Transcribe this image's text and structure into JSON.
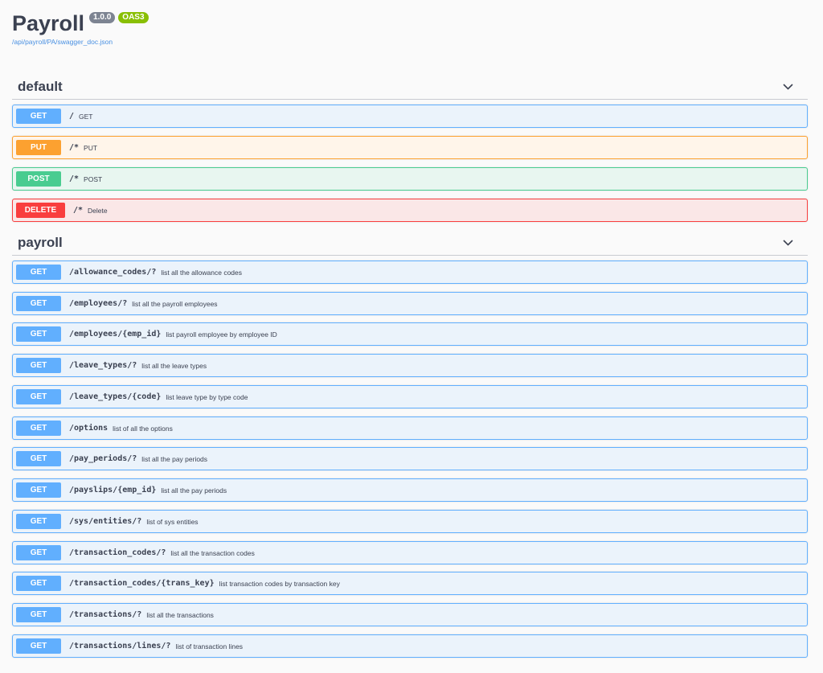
{
  "info": {
    "title": "Payroll",
    "version": "1.0.0",
    "oas": "OAS3",
    "spec_url": "/api/payroll/PA/swagger_doc.json"
  },
  "sections": [
    {
      "name": "default",
      "chevron_icon": "chevron-down-icon",
      "operations": [
        {
          "method": "GET",
          "path": "/",
          "summary": "GET"
        },
        {
          "method": "PUT",
          "path": "/*",
          "summary": "PUT"
        },
        {
          "method": "POST",
          "path": "/*",
          "summary": "POST"
        },
        {
          "method": "DELETE",
          "path": "/*",
          "summary": "Delete"
        }
      ]
    },
    {
      "name": "payroll",
      "chevron_icon": "chevron-down-icon",
      "operations": [
        {
          "method": "GET",
          "path": "/allowance_codes/?",
          "summary": "list all the allowance codes"
        },
        {
          "method": "GET",
          "path": "/employees/?",
          "summary": "list all the payroll employees"
        },
        {
          "method": "GET",
          "path": "/employees/{emp_id}",
          "summary": "list payroll employee by employee ID"
        },
        {
          "method": "GET",
          "path": "/leave_types/?",
          "summary": "list all the leave types"
        },
        {
          "method": "GET",
          "path": "/leave_types/{code}",
          "summary": "list leave type by type code"
        },
        {
          "method": "GET",
          "path": "/options",
          "summary": "list of all the options"
        },
        {
          "method": "GET",
          "path": "/pay_periods/?",
          "summary": "list all the pay periods"
        },
        {
          "method": "GET",
          "path": "/payslips/{emp_id}",
          "summary": "list all the pay periods"
        },
        {
          "method": "GET",
          "path": "/sys/entities/?",
          "summary": "list of sys entities"
        },
        {
          "method": "GET",
          "path": "/transaction_codes/?",
          "summary": "list all the transaction codes"
        },
        {
          "method": "GET",
          "path": "/transaction_codes/{trans_key}",
          "summary": "list transaction codes by transaction key"
        },
        {
          "method": "GET",
          "path": "/transactions/?",
          "summary": "list all the transactions"
        },
        {
          "method": "GET",
          "path": "/transactions/lines/?",
          "summary": "list of transaction lines"
        }
      ]
    }
  ],
  "colors": {
    "get": "#61affe",
    "put": "#fca130",
    "post": "#49cc90",
    "delete": "#f93e3e",
    "version_badge": "#7d8492",
    "oas_badge": "#89bf04",
    "link": "#4990e2"
  }
}
